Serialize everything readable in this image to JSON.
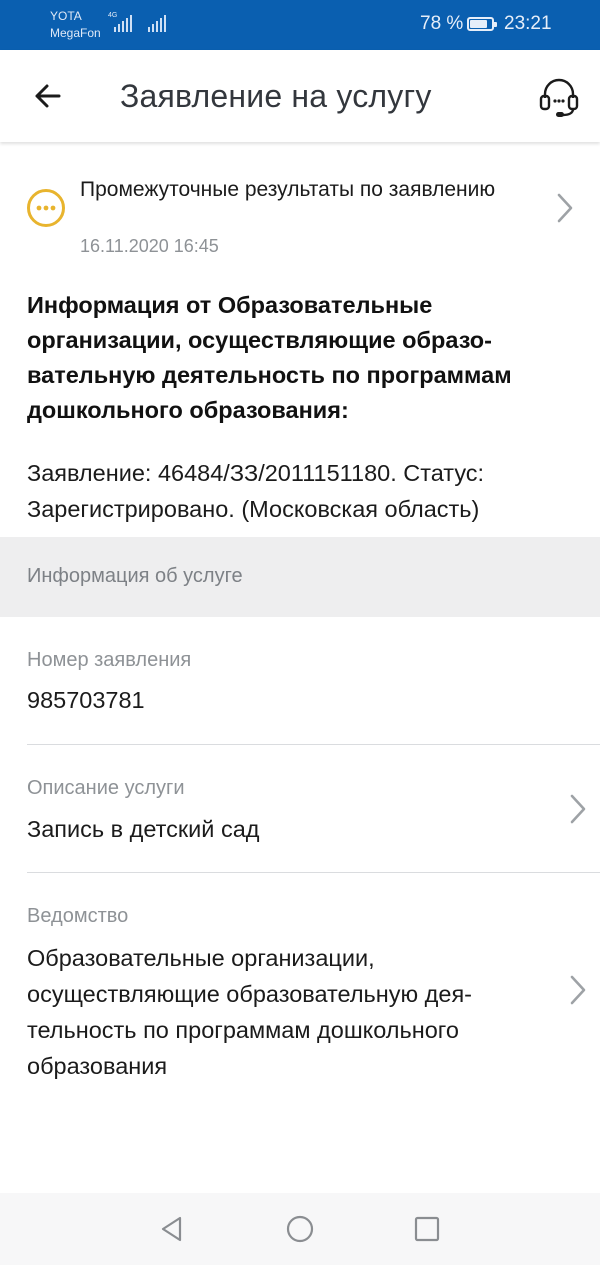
{
  "status_bar": {
    "carrier_1": "YOTA",
    "carrier_2": "MegaFon",
    "network_type": "4G",
    "battery_percent": "78 %",
    "time": "23:21"
  },
  "app_bar": {
    "title": "Заявление на услугу",
    "icons": {
      "back": "arrow-left-icon",
      "support": "headset-icon"
    }
  },
  "notification": {
    "title": "Промежуточные результаты по заявлению",
    "date": "16.11.2020 16:45",
    "icon": "dots-in-circle-icon",
    "accent_color": "#e8b42e"
  },
  "message": {
    "heading": "Информация от Образовательные организации, осуществляющие образо-вательную деятельность по программам дошкольного образования:",
    "body": "Заявление: 46484/ЗЗ/2011151180. Статус: Зарегистрировано. (Московская область)"
  },
  "service_info": {
    "section_title": "Информация об услуге",
    "fields": [
      {
        "label": "Номер заявления",
        "value": "985703781"
      },
      {
        "label": "Описание услуги",
        "value": "Запись в детский сад"
      },
      {
        "label": "Ведомство",
        "value": "Образовательные организации, осуществляющие образовательную дея-тельность по программам дошкольного образования"
      }
    ]
  },
  "colors": {
    "status_bar": "#0a5fb0",
    "section_background": "#eeeeef",
    "secondary_text": "#8e9296"
  }
}
